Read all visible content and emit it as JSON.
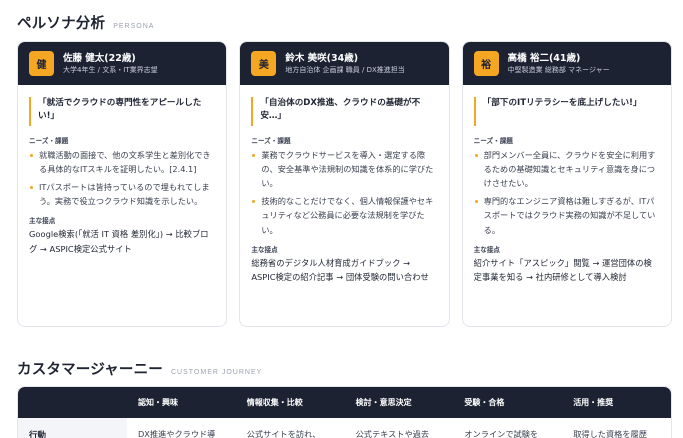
{
  "persona_section": {
    "title": "ペルソナ分析",
    "subtitle": "PERSONA"
  },
  "personas": [
    {
      "avatar_char": "健",
      "name": "佐藤 健太(22歳)",
      "role": "大学4年生 / 文系・IT業界志望",
      "quote": "「就活でクラウドの専門性をアピールしたい!」",
      "needs_label": "ニーズ・課題",
      "needs": [
        "就職活動の面接で、他の文系学生と差別化できる具体的なITスキルを証明したい。[2.4.1]",
        "ITパスポートは皆持っているので埋もれてしまう。実務で役立つクラウド知識を示したい。"
      ],
      "touchpoint_label": "主な接点",
      "touchpoint": "Google検索(「就活 IT 資格 差別化」) → 比較ブログ → ASPIC検定公式サイト"
    },
    {
      "avatar_char": "美",
      "name": "鈴木 美咲(34歳)",
      "role": "地方自治体 企画課 職員 / DX推進担当",
      "quote": "「自治体のDX推進、クラウドの基礎が不安…」",
      "needs_label": "ニーズ・課題",
      "needs": [
        "業務でクラウドサービスを導入・選定する際の、安全基準や法規制の知識を体系的に学びたい。",
        "技術的なことだけでなく、個人情報保護やセキュリティなど公務員に必要な法規制を学びたい。"
      ],
      "touchpoint_label": "主な接点",
      "touchpoint": "総務省のデジタル人材育成ガイドブック → ASPIC検定の紹介記事 → 団体受験の問い合わせ"
    },
    {
      "avatar_char": "裕",
      "name": "高橋 裕二(41歳)",
      "role": "中堅製造業 総務部 マネージャー",
      "quote": "「部下のITリテラシーを底上げしたい!」",
      "needs_label": "ニーズ・課題",
      "needs": [
        "部門メンバー全員に、クラウドを安全に利用するための基礎知識とセキュリティ意識を身につけさせたい。",
        "専門的なエンジニア資格は難しすぎるが、ITパスポートではクラウド実務の知識が不足している。"
      ],
      "touchpoint_label": "主な接点",
      "touchpoint": "紹介サイト「アスピック」閲覧 → 運営団体の検定事業を知る → 社内研修として導入検討"
    }
  ],
  "journey_section": {
    "title": "カスタマージャーニー",
    "subtitle": "CUSTOMER JOURNEY"
  },
  "journey_table": {
    "columns": [
      "",
      "認知・興味",
      "情報収集・比較",
      "検討・意思決定",
      "受験・合格",
      "活用・推奨"
    ],
    "rows": [
      {
        "label": "行動",
        "cells": [
          "DX推進やクラウド導",
          "公式サイトを訪れ、",
          "公式テキストや過去",
          "オンラインで試験を",
          "取得した資格を履歴"
        ]
      }
    ]
  },
  "colors": {
    "accent": "#f5a623",
    "header_dark": "#1d2233",
    "border": "#e2e5eb"
  }
}
